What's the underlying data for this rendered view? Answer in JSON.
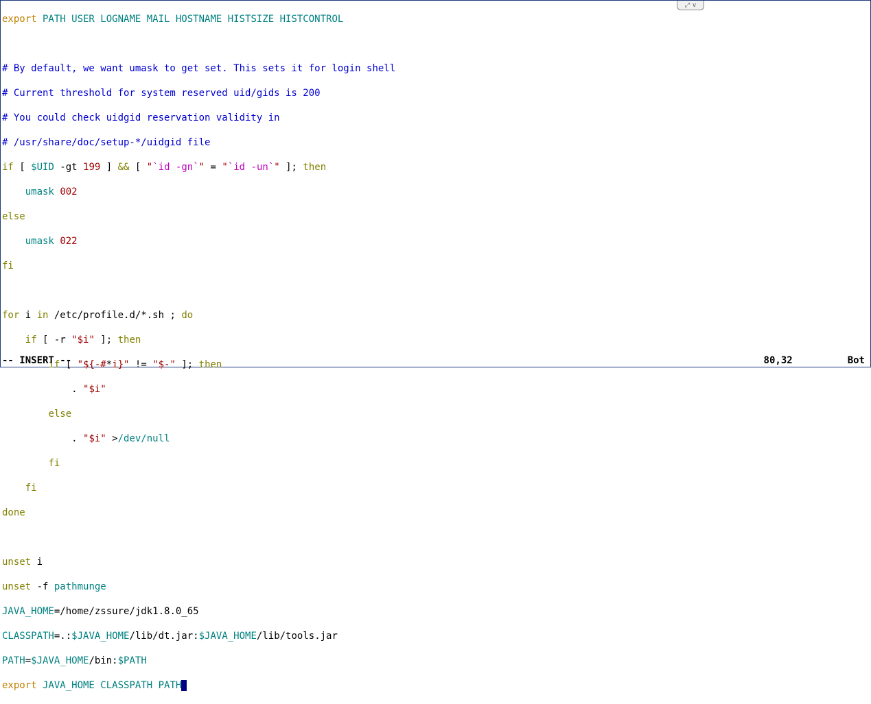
{
  "toolbar": {
    "icon1": "⤢",
    "icon2": "v"
  },
  "code": {
    "l1_export": "export",
    "l1_vars": " PATH USER LOGNAME MAIL HOSTNAME HISTSIZE HISTCONTROL",
    "l3": "# By default, we want umask to get set. This sets it for login shell",
    "l4": "# Current threshold for system reserved uid/gids is 200",
    "l5": "# You could check uidgid reservation validity in",
    "l6": "# /usr/share/doc/setup-*/uidgid file",
    "l7_if": "if",
    "l7_a": " [ ",
    "l7_uid": "$UID",
    "l7_b": " -gt ",
    "l7_num": "199",
    "l7_c": " ] ",
    "l7_amp": "&&",
    "l7_d": " [ ",
    "l7_q1": "\"",
    "l7_bt1": "`id -gn`",
    "l7_q2": "\"",
    "l7_eq": " = ",
    "l7_q3": "\"",
    "l7_bt2": "`id -un`",
    "l7_q4": "\"",
    "l7_e": " ]; ",
    "l7_then": "then",
    "l8_indent": "    ",
    "l8_umask": "umask",
    "l8_sp": " ",
    "l8_val": "002",
    "l9_else": "else",
    "l10_indent": "    ",
    "l10_umask": "umask",
    "l10_sp": " ",
    "l10_val": "022",
    "l11_fi": "fi",
    "l13_for": "for",
    "l13_a": " i ",
    "l13_in": "in",
    "l13_b": " /etc/profile.d/*.sh ; ",
    "l13_do": "do",
    "l14_indent": "    ",
    "l14_if": "if",
    "l14_a": " [ -r ",
    "l14_str": "\"$i\"",
    "l14_b": " ]; ",
    "l14_then": "then",
    "l15_indent": "        ",
    "l15_if": "if",
    "l15_a": " [ ",
    "l15_s1": "\"${-#",
    "l15_star": "*",
    "l15_s2": "i}\"",
    "l15_ne": " != ",
    "l15_s3": "\"$-\"",
    "l15_b": " ]; ",
    "l15_then": "then",
    "l16_a": "            . ",
    "l16_str": "\"$i\"",
    "l17_indent": "        ",
    "l17_else": "else",
    "l18_a": "            . ",
    "l18_str": "\"$i\"",
    "l18_b": " >",
    "l18_dev": "/dev/null",
    "l19_indent": "        ",
    "l19_fi": "fi",
    "l20_indent": "    ",
    "l20_fi": "fi",
    "l21_done": "done",
    "l23_unset": "unset",
    "l23_a": " i",
    "l24_unset": "unset",
    "l24_a": " -f ",
    "l24_fn": "pathmunge",
    "l25_var": "JAVA_HOME",
    "l25_eq": "=",
    "l25_val": "/home/zssure/jdk1.8.0_65",
    "l26_var": "CLASSPATH",
    "l26_eq": "=",
    "l26_a": ".:",
    "l26_v1": "$JAVA_HOME",
    "l26_b": "/lib/dt.jar:",
    "l26_v2": "$JAVA_HOME",
    "l26_c": "/lib/tools.jar",
    "l27_var": "PATH",
    "l27_eq": "=",
    "l27_v1": "$JAVA_HOME",
    "l27_a": "/bin:",
    "l27_v2": "$PATH",
    "l28_export": "export",
    "l28_vars": " JAVA_HOME CLASSPATH PATH"
  },
  "status": {
    "mode": "-- INSERT --",
    "position": "80,32",
    "scroll": "Bot"
  }
}
